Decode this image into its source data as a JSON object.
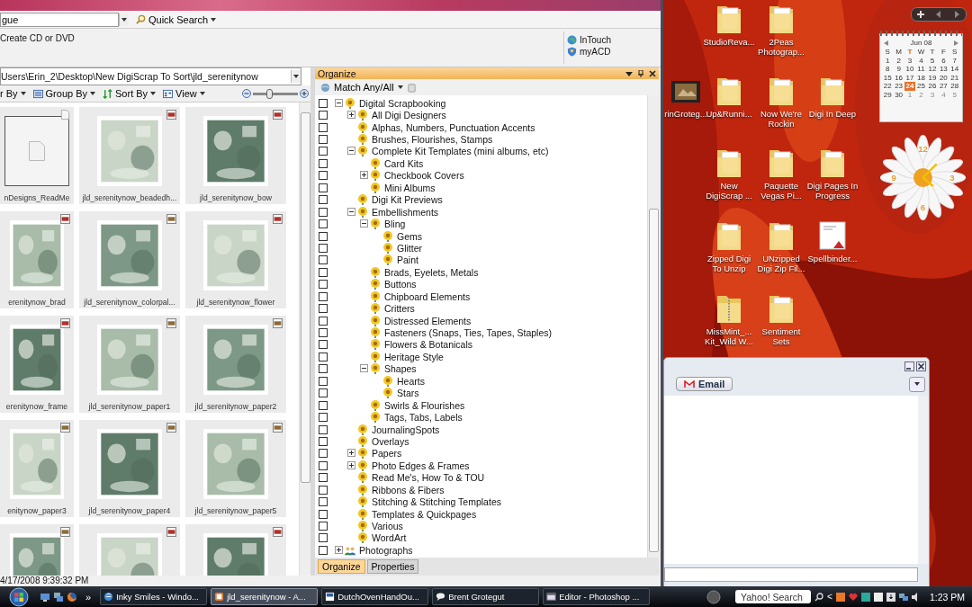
{
  "main_window": {
    "search": {
      "value": "gue"
    },
    "quick_search": "Quick Search",
    "actions": [
      "Create CD or DVD"
    ],
    "links": [
      {
        "label": "InTouch",
        "kind": "globe"
      },
      {
        "label": "myACD",
        "kind": "shield"
      }
    ],
    "path": "Users\\Erin_2\\Desktop\\New DigiScrap To Sort\\jld_serenitynow",
    "toolbar": [
      {
        "label": "r By",
        "kind": "filter"
      },
      {
        "label": "Group By",
        "kind": "group"
      },
      {
        "label": "Sort By",
        "kind": "sort"
      },
      {
        "label": "View",
        "kind": "view"
      }
    ],
    "zoom": {
      "level": 0.35
    },
    "thumbnails": [
      {
        "label": "nDesigns_ReadMe",
        "kind": "doc"
      },
      {
        "label": "jld_serenitynow_beadedh...",
        "kind": "png"
      },
      {
        "label": "jld_serenitynow_bow",
        "kind": "png"
      },
      {
        "label": "erenitynow_brad",
        "kind": "png"
      },
      {
        "label": "jld_serenitynow_colorpal...",
        "kind": "jpg"
      },
      {
        "label": "jld_serenitynow_flower",
        "kind": "png"
      },
      {
        "label": "erenitynow_frame",
        "kind": "png"
      },
      {
        "label": "jld_serenitynow_paper1",
        "kind": "jpg"
      },
      {
        "label": "jld_serenitynow_paper2",
        "kind": "jpg"
      },
      {
        "label": "enitynow_paper3",
        "kind": "jpg"
      },
      {
        "label": "jld_serenitynow_paper4",
        "kind": "jpg"
      },
      {
        "label": "jld_serenitynow_paper5",
        "kind": "jpg"
      },
      {
        "kind": "jpg"
      },
      {
        "kind": "png"
      },
      {
        "kind": "png"
      }
    ],
    "status": "4/17/2008 9:39:32 PM",
    "organize": {
      "title": "Organize",
      "match": "Match Any/All",
      "tree": [
        {
          "label": "Digital Scrapbooking",
          "kind": "category",
          "checked": false,
          "expanded": true,
          "children": [
            {
              "label": "All Digi Designers",
              "kind": "category",
              "checked": false,
              "expanded": false
            },
            {
              "label": "Alphas, Numbers, Punctuation Accents",
              "kind": "category",
              "checked": false
            },
            {
              "label": "Brushes, Flourishes, Stamps",
              "kind": "category",
              "checked": false
            },
            {
              "label": "Complete Kit Templates (mini albums, etc)",
              "kind": "category",
              "checked": false,
              "expanded": true,
              "children": [
                {
                  "label": "Card Kits",
                  "kind": "category",
                  "checked": false
                },
                {
                  "label": "Checkbook Covers",
                  "kind": "category",
                  "checked": false,
                  "expanded": false
                },
                {
                  "label": "Mini Albums",
                  "kind": "category",
                  "checked": false
                }
              ]
            },
            {
              "label": "Digi Kit Previews",
              "kind": "category",
              "checked": false
            },
            {
              "label": "Embellishments",
              "kind": "category",
              "checked": false,
              "expanded": true,
              "children": [
                {
                  "label": "Bling",
                  "kind": "category",
                  "checked": false,
                  "expanded": true,
                  "children": [
                    {
                      "label": "Gems",
                      "kind": "category",
                      "checked": false
                    },
                    {
                      "label": "Glitter",
                      "kind": "category",
                      "checked": false
                    },
                    {
                      "label": "Paint",
                      "kind": "category",
                      "checked": false
                    }
                  ]
                },
                {
                  "label": "Brads, Eyelets, Metals",
                  "kind": "category",
                  "checked": false
                },
                {
                  "label": "Buttons",
                  "kind": "category",
                  "checked": false
                },
                {
                  "label": "Chipboard Elements",
                  "kind": "category",
                  "checked": false
                },
                {
                  "label": "Critters",
                  "kind": "category",
                  "checked": false
                },
                {
                  "label": "Distressed Elements",
                  "kind": "category",
                  "checked": false
                },
                {
                  "label": "Fasteners (Snaps, Ties, Tapes, Staples)",
                  "kind": "category",
                  "checked": false
                },
                {
                  "label": "Flowers & Botanicals",
                  "kind": "category",
                  "checked": false
                },
                {
                  "label": "Heritage Style",
                  "kind": "category",
                  "checked": false
                },
                {
                  "label": "Shapes",
                  "kind": "category",
                  "checked": false,
                  "expanded": true,
                  "children": [
                    {
                      "label": "Hearts",
                      "kind": "category",
                      "checked": false
                    },
                    {
                      "label": "Stars",
                      "kind": "category",
                      "checked": false
                    }
                  ]
                },
                {
                  "label": "Swirls & Flourishes",
                  "kind": "category",
                  "checked": false
                },
                {
                  "label": "Tags, Tabs, Labels",
                  "kind": "category",
                  "checked": false
                }
              ]
            },
            {
              "label": "JournalingSpots",
              "kind": "category",
              "checked": false
            },
            {
              "label": "Overlays",
              "kind": "category",
              "checked": false
            },
            {
              "label": "Papers",
              "kind": "category",
              "checked": false,
              "expanded": false
            },
            {
              "label": "Photo Edges & Frames",
              "kind": "category",
              "checked": false,
              "expanded": false
            },
            {
              "label": "Read Me's, How To & TOU",
              "kind": "category",
              "checked": false
            },
            {
              "label": "Ribbons & Fibers",
              "kind": "category",
              "checked": false
            },
            {
              "label": "Stitching & Stitching Templates",
              "kind": "category",
              "checked": false
            },
            {
              "label": "Templates & Quickpages",
              "kind": "category",
              "checked": false
            },
            {
              "label": "Various",
              "kind": "category",
              "checked": false
            },
            {
              "label": "WordArt",
              "kind": "category",
              "checked": false
            }
          ]
        },
        {
          "label": "Photographs",
          "kind": "people",
          "checked": false,
          "expanded": false
        }
      ],
      "tabs": [
        {
          "label": "Organize",
          "selected": true
        },
        {
          "label": "Properties",
          "selected": false
        }
      ]
    }
  },
  "desktop": {
    "icons": [
      {
        "lines": [
          "StudioReva..."
        ],
        "kind": "folder"
      },
      {
        "lines": [
          "2Peas",
          "Photograp..."
        ],
        "kind": "folder"
      },
      {
        "lines": [
          "rinGroteg..."
        ],
        "kind": "video"
      },
      {
        "lines": [
          "Up&Runni..."
        ],
        "kind": "folder"
      },
      {
        "lines": [
          "Now We're",
          "Rockin"
        ],
        "kind": "folder"
      },
      {
        "lines": [
          "Digi In Deep"
        ],
        "kind": "folder"
      },
      {
        "lines": [
          "New",
          "DigiScrap ..."
        ],
        "kind": "folder"
      },
      {
        "lines": [
          "Paquette",
          "Vegas Pi..."
        ],
        "kind": "folder"
      },
      {
        "lines": [
          "Digi Pages In",
          "Progress"
        ],
        "kind": "folder"
      },
      {
        "lines": [
          "Zipped Digi",
          "To Unzip"
        ],
        "kind": "folder"
      },
      {
        "lines": [
          "UNzipped",
          "Digi Zip Fil..."
        ],
        "kind": "folder"
      },
      {
        "lines": [
          "Spellbinder..."
        ],
        "kind": "pdf"
      },
      {
        "lines": [
          "MissMint_...",
          "Kit_Wild W..."
        ],
        "kind": "zip"
      },
      {
        "lines": [
          "Sentiment",
          "Sets"
        ],
        "kind": "folder"
      }
    ],
    "calendar": {
      "month": "Jun 08",
      "weekdays": [
        {
          "label": "S",
          "selected": false
        },
        {
          "label": "M",
          "selected": false
        },
        {
          "label": "T",
          "selected": true
        },
        {
          "label": "W",
          "selected": false
        },
        {
          "label": "T",
          "selected": false
        },
        {
          "label": "F",
          "selected": false
        },
        {
          "label": "S",
          "selected": false
        }
      ],
      "days": [
        {
          "day": "1",
          "selected": false,
          "outside": false
        },
        {
          "day": "2",
          "selected": false,
          "outside": false
        },
        {
          "day": "3",
          "selected": false,
          "outside": false
        },
        {
          "day": "4",
          "selected": false,
          "outside": false
        },
        {
          "day": "5",
          "selected": false,
          "outside": false
        },
        {
          "day": "6",
          "selected": false,
          "outside": false
        },
        {
          "day": "7",
          "selected": false,
          "outside": false
        },
        {
          "day": "8",
          "selected": false,
          "outside": false
        },
        {
          "day": "9",
          "selected": false,
          "outside": false
        },
        {
          "day": "10",
          "selected": false,
          "outside": false
        },
        {
          "day": "11",
          "selected": false,
          "outside": false
        },
        {
          "day": "12",
          "selected": false,
          "outside": false
        },
        {
          "day": "13",
          "selected": false,
          "outside": false
        },
        {
          "day": "14",
          "selected": false,
          "outside": false
        },
        {
          "day": "15",
          "selected": false,
          "outside": false
        },
        {
          "day": "16",
          "selected": false,
          "outside": false
        },
        {
          "day": "17",
          "selected": false,
          "outside": false
        },
        {
          "day": "18",
          "selected": false,
          "outside": false
        },
        {
          "day": "19",
          "selected": false,
          "outside": false
        },
        {
          "day": "20",
          "selected": false,
          "outside": false
        },
        {
          "day": "21",
          "selected": false,
          "outside": false
        },
        {
          "day": "22",
          "selected": false,
          "outside": false
        },
        {
          "day": "23",
          "selected": false,
          "outside": false
        },
        {
          "day": "24",
          "selected": true,
          "outside": false
        },
        {
          "day": "25",
          "selected": false,
          "outside": false
        },
        {
          "day": "26",
          "selected": false,
          "outside": false
        },
        {
          "day": "27",
          "selected": false,
          "outside": false
        },
        {
          "day": "28",
          "selected": false,
          "outside": false
        },
        {
          "day": "29",
          "selected": false,
          "outside": false
        },
        {
          "day": "30",
          "selected": false,
          "outside": false
        },
        {
          "day": "1",
          "selected": false,
          "outside": true
        },
        {
          "day": "2",
          "selected": false,
          "outside": true
        },
        {
          "day": "3",
          "selected": false,
          "outside": true
        },
        {
          "day": "4",
          "selected": false,
          "outside": true
        },
        {
          "day": "5",
          "selected": false,
          "outside": true
        }
      ]
    },
    "clock": {
      "numbers": [
        "12",
        "3",
        "6",
        "9"
      ]
    }
  },
  "chat_window": {
    "email_button": "Email"
  },
  "taskbar": {
    "overflow": "»",
    "tasks": [
      {
        "label": "Inky Smiles - Windo...",
        "kind": "browser",
        "selected": false
      },
      {
        "label": "jld_serenitynow - A...",
        "kind": "viewer",
        "selected": true
      },
      {
        "label": "DutchOvenHandOu...",
        "kind": "document",
        "selected": false
      },
      {
        "label": "Brent Grotegut",
        "kind": "chat",
        "selected": false
      },
      {
        "label": "Editor - Photoshop ...",
        "kind": "window",
        "selected": false
      }
    ],
    "search": {
      "placeholder": "Yahoo! Search"
    },
    "tray_arrow": "<",
    "clock": "1:23 PM"
  }
}
